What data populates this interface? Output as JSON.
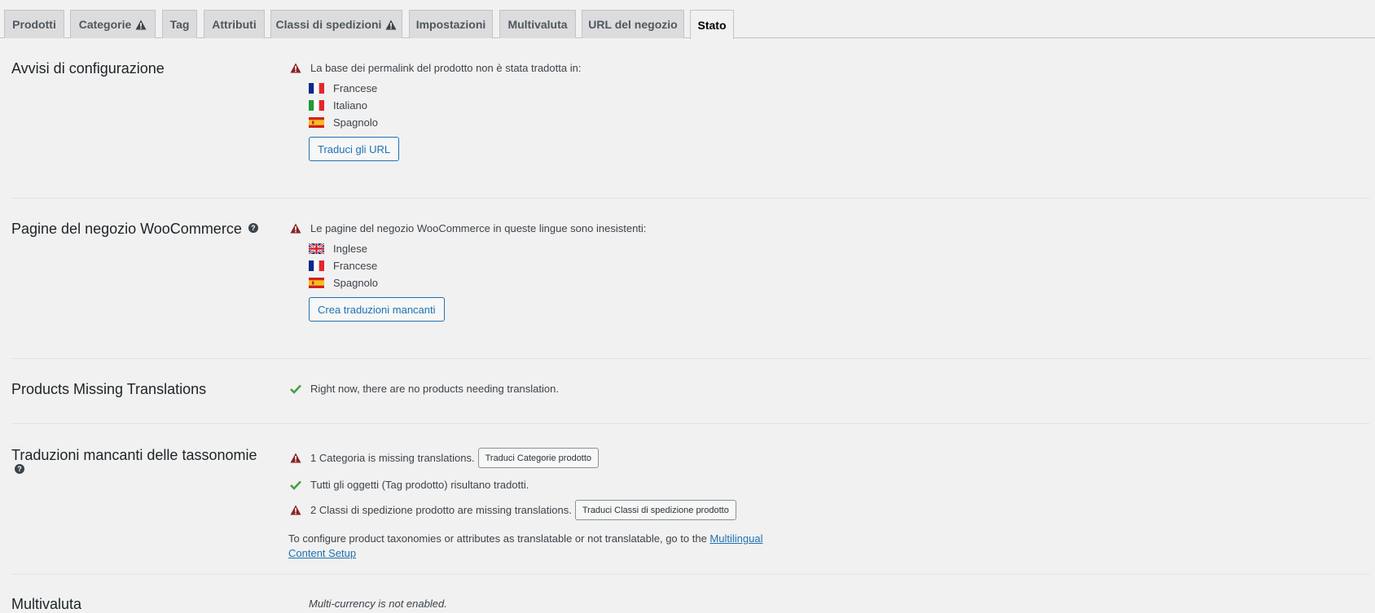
{
  "tabs": [
    {
      "label": "Prodotti",
      "warning": false
    },
    {
      "label": "Categorie",
      "warning": true
    },
    {
      "label": "Tag",
      "warning": false
    },
    {
      "label": "Attributi",
      "warning": false
    },
    {
      "label": "Classi di spedizioni",
      "warning": true
    },
    {
      "label": "Impostazioni",
      "warning": false
    },
    {
      "label": "Multivaluta",
      "warning": false
    },
    {
      "label": "URL del negozio",
      "warning": false
    },
    {
      "label": "Stato",
      "warning": false,
      "active": true
    }
  ],
  "config": {
    "title": "Avvisi di configurazione",
    "message": "La base dei permalink del prodotto non è stata tradotta in:",
    "languages": [
      "Francese",
      "Italiano",
      "Spagnolo"
    ],
    "button": "Traduci gli URL"
  },
  "shop_pages": {
    "title": "Pagine del negozio WooCommerce",
    "message": "Le pagine del negozio WooCommerce in queste lingue sono inesistenti:",
    "languages": [
      "Inglese",
      "Francese",
      "Spagnolo"
    ],
    "button": "Crea traduzioni mancanti"
  },
  "products": {
    "title": "Products Missing Translations",
    "message": "Right now, there are no products needing translation."
  },
  "taxonomies": {
    "title": "Traduzioni mancanti delle tassonomie",
    "row1_text": "1 Categoria is missing translations.",
    "row1_button": "Traduci Categorie prodotto",
    "row2_text": "Tutti gli oggetti (Tag prodotto) risultano tradotti.",
    "row3_text": "2 Classi di spedizione prodotto are missing translations.",
    "row3_button": "Traduci Classi di spedizione prodotto",
    "note_text": "To configure product taxonomies or attributes as translatable or not translatable, go to the ",
    "note_link": "Multilingual Content Setup"
  },
  "multicurrency": {
    "title": "Multivaluta",
    "message": "Multi-currency is not enabled."
  },
  "colors": {
    "warning": "#8a2424",
    "success": "#46a046",
    "link": "#2271b1"
  }
}
